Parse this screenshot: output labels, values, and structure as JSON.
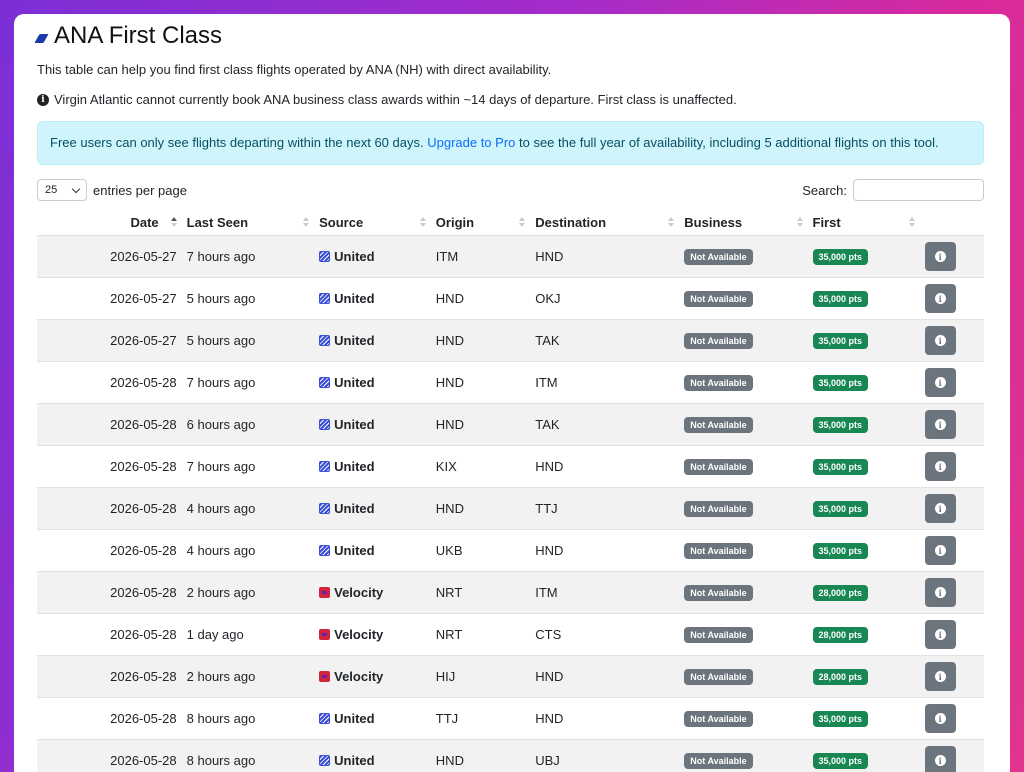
{
  "page": {
    "title": "ANA First Class",
    "description": "This table can help you find first class flights operated by ANA (NH) with direct availability.",
    "note": "Virgin Atlantic cannot currently book ANA business class awards within ~14 days of departure. First class is unaffected."
  },
  "alert": {
    "text_before": "Free users can only see flights departing within the next 60 days. ",
    "link": "Upgrade to Pro",
    "text_after": " to see the full year of availability, including 5 additional flights on this tool."
  },
  "controls": {
    "page_length": "25",
    "page_length_label": "entries per page",
    "search_label": "Search:",
    "search_value": ""
  },
  "columns": [
    "Date",
    "Last Seen",
    "Source",
    "Origin",
    "Destination",
    "Business",
    "First"
  ],
  "sort": {
    "column": "Date",
    "direction": "asc"
  },
  "rows": [
    {
      "date": "2026-05-27",
      "seen": "7 hours ago",
      "source": "United",
      "source_icon": "united-icon",
      "origin": "ITM",
      "destination": "HND",
      "business": "Not Available",
      "first": "35,000 pts"
    },
    {
      "date": "2026-05-27",
      "seen": "5 hours ago",
      "source": "United",
      "source_icon": "united-icon",
      "origin": "HND",
      "destination": "OKJ",
      "business": "Not Available",
      "first": "35,000 pts"
    },
    {
      "date": "2026-05-27",
      "seen": "5 hours ago",
      "source": "United",
      "source_icon": "united-icon",
      "origin": "HND",
      "destination": "TAK",
      "business": "Not Available",
      "first": "35,000 pts"
    },
    {
      "date": "2026-05-28",
      "seen": "7 hours ago",
      "source": "United",
      "source_icon": "united-icon",
      "origin": "HND",
      "destination": "ITM",
      "business": "Not Available",
      "first": "35,000 pts"
    },
    {
      "date": "2026-05-28",
      "seen": "6 hours ago",
      "source": "United",
      "source_icon": "united-icon",
      "origin": "HND",
      "destination": "TAK",
      "business": "Not Available",
      "first": "35,000 pts"
    },
    {
      "date": "2026-05-28",
      "seen": "7 hours ago",
      "source": "United",
      "source_icon": "united-icon",
      "origin": "KIX",
      "destination": "HND",
      "business": "Not Available",
      "first": "35,000 pts"
    },
    {
      "date": "2026-05-28",
      "seen": "4 hours ago",
      "source": "United",
      "source_icon": "united-icon",
      "origin": "HND",
      "destination": "TTJ",
      "business": "Not Available",
      "first": "35,000 pts"
    },
    {
      "date": "2026-05-28",
      "seen": "4 hours ago",
      "source": "United",
      "source_icon": "united-icon",
      "origin": "UKB",
      "destination": "HND",
      "business": "Not Available",
      "first": "35,000 pts"
    },
    {
      "date": "2026-05-28",
      "seen": "2 hours ago",
      "source": "Velocity",
      "source_icon": "velocity-icon",
      "origin": "NRT",
      "destination": "ITM",
      "business": "Not Available",
      "first": "28,000 pts"
    },
    {
      "date": "2026-05-28",
      "seen": "1 day ago",
      "source": "Velocity",
      "source_icon": "velocity-icon",
      "origin": "NRT",
      "destination": "CTS",
      "business": "Not Available",
      "first": "28,000 pts"
    },
    {
      "date": "2026-05-28",
      "seen": "2 hours ago",
      "source": "Velocity",
      "source_icon": "velocity-icon",
      "origin": "HIJ",
      "destination": "HND",
      "business": "Not Available",
      "first": "28,000 pts"
    },
    {
      "date": "2026-05-28",
      "seen": "8 hours ago",
      "source": "United",
      "source_icon": "united-icon",
      "origin": "TTJ",
      "destination": "HND",
      "business": "Not Available",
      "first": "35,000 pts"
    },
    {
      "date": "2026-05-28",
      "seen": "8 hours ago",
      "source": "United",
      "source_icon": "united-icon",
      "origin": "HND",
      "destination": "UBJ",
      "business": "Not Available",
      "first": "35,000 pts"
    }
  ],
  "colors": {
    "not_available_badge": "#6c757d",
    "points_badge": "#198754",
    "alert_bg": "#cff4fc",
    "link": "#0d6efd",
    "united_icon": "#3b4fd8",
    "velocity_icon": "#d0253a"
  }
}
